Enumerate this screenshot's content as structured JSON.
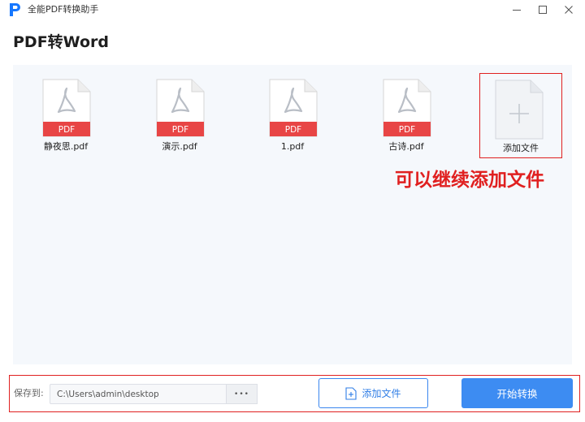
{
  "window": {
    "title": "全能PDF转换助手",
    "logo_icon": "app-logo-icon",
    "controls": [
      "minimize-icon",
      "maximize-icon",
      "close-icon"
    ]
  },
  "page": {
    "title": "PDF转Word"
  },
  "files": [
    {
      "name": "静夜思.pdf",
      "badge": "PDF",
      "icon": "pdf-file-icon"
    },
    {
      "name": "演示.pdf",
      "badge": "PDF",
      "icon": "pdf-file-icon"
    },
    {
      "name": "1.pdf",
      "badge": "PDF",
      "icon": "pdf-file-icon"
    },
    {
      "name": "古诗.pdf",
      "badge": "PDF",
      "icon": "pdf-file-icon"
    }
  ],
  "add_card": {
    "label": "添加文件",
    "icon": "plus-icon"
  },
  "annotation": {
    "text": "可以继续添加文件"
  },
  "bottom": {
    "save_label": "保存到:",
    "path_value": "C:\\Users\\admin\\desktop",
    "browse_label": "•••",
    "add_button_label": "添加文件",
    "start_button_label": "开始转换"
  },
  "colors": {
    "accent": "#3d8cf2",
    "pdf_red": "#e84545",
    "annotation_red": "#e02020",
    "file_area_bg": "#f5f8fc"
  }
}
